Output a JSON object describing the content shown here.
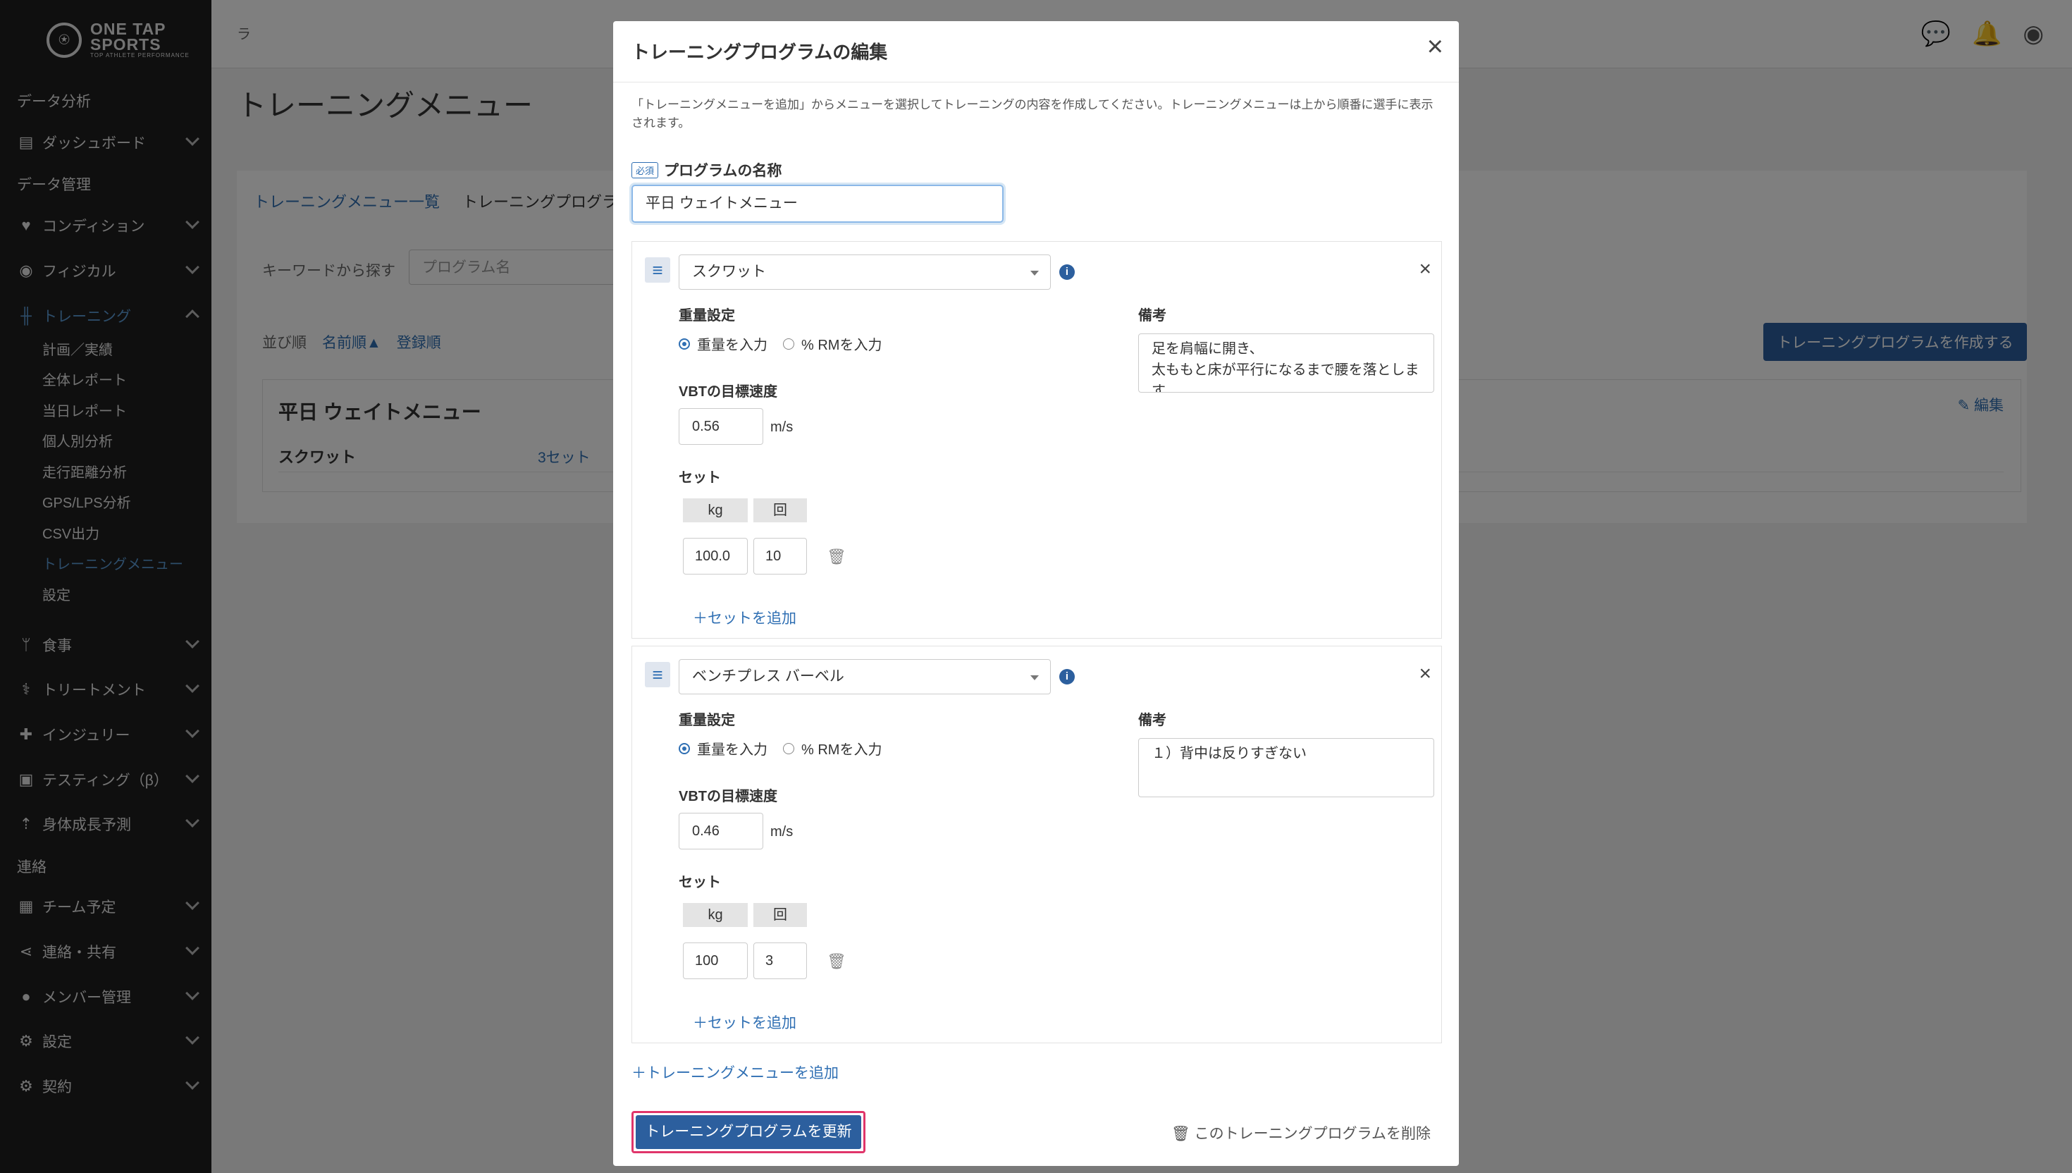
{
  "sidebar": {
    "brand_line1": "ONE TAP",
    "brand_line2": "SPORTS",
    "brand_tagline": "TOP ATHLETE PERFORMANCE",
    "sections": [
      {
        "label": "データ分析"
      },
      {
        "label": "ダッシュボード",
        "icon": "id-card-icon"
      },
      {
        "label": "データ管理"
      },
      {
        "label": "コンディション",
        "icon": "heartbeat-icon"
      },
      {
        "label": "フィジカル",
        "icon": "user-circle-icon"
      },
      {
        "label": "トレーニング",
        "icon": "dumbbell-icon"
      },
      {
        "label": "食事",
        "icon": "utensils-icon"
      },
      {
        "label": "トリートメント",
        "icon": "treatment-icon"
      },
      {
        "label": "インジュリー",
        "icon": "first-aid-icon"
      },
      {
        "label": "テスティング（β）",
        "icon": "testing-icon"
      },
      {
        "label": "身体成長予測",
        "icon": "growth-icon"
      },
      {
        "label": "連絡"
      },
      {
        "label": "チーム予定",
        "icon": "calendar-icon"
      },
      {
        "label": "連絡・共有",
        "icon": "share-icon"
      },
      {
        "label": "メンバー管理",
        "icon": "user-icon"
      },
      {
        "label": "設定",
        "icon": "gear-icon"
      },
      {
        "label": "契約",
        "icon": "gear-icon"
      }
    ],
    "training_sub": [
      "計画／実績",
      "全体レポート",
      "当日レポート",
      "個人別分析",
      "走行距離分析",
      "GPS/LPS分析",
      "CSV出力",
      "トレーニングメニュー",
      "設定"
    ]
  },
  "topbar": {
    "crumb": "ラ"
  },
  "page": {
    "title": "トレーニングメニュー",
    "tabs": [
      "トレーニングメニュー一覧",
      "トレーニングプログラ"
    ],
    "search_label": "キーワードから探す",
    "search_placeholder": "プログラム名",
    "sort_label": "並び順",
    "sort_name": "名前順▲",
    "sort_reg": "登録順",
    "create_button": "トレーニングプログラムを作成する",
    "card": {
      "name": "平日 ウェイトメニュー",
      "exercise": "スクワット",
      "sets": "3セット",
      "edit": "編集"
    }
  },
  "modal": {
    "title": "トレーニングプログラムの編集",
    "close": "×",
    "description": "「トレーニングメニューを追加」からメニューを選択してトレーニングの内容を作成してください。トレーニングメニューは上から順番に選手に表示されます。",
    "required_badge": "必須",
    "name_label": "プログラムの名称",
    "name_value": "平日 ウェイトメニュー",
    "exercises": [
      {
        "menu": "スクワット",
        "weight_setting_label": "重量設定",
        "radio_weight": "重量を入力",
        "radio_rm": "% RMを入力",
        "vbt_label": "VBTの目標速度",
        "vbt_value": "0.56",
        "vbt_unit": "m/s",
        "sets_label": "セット",
        "col_kg": "kg",
        "col_reps": "回",
        "sets": [
          {
            "kg": "100.0",
            "reps": "10"
          }
        ],
        "add_set": "セットを追加",
        "note_label": "備考",
        "note": "足を肩幅に開き、\n太ももと床が平行になるまで腰を落とします"
      },
      {
        "menu": "ベンチプレス バーベル",
        "weight_setting_label": "重量設定",
        "radio_weight": "重量を入力",
        "radio_rm": "% RMを入力",
        "vbt_label": "VBTの目標速度",
        "vbt_value": "0.46",
        "vbt_unit": "m/s",
        "sets_label": "セット",
        "col_kg": "kg",
        "col_reps": "回",
        "sets": [
          {
            "kg": "100",
            "reps": "3"
          }
        ],
        "add_set": "セットを追加",
        "note_label": "備考",
        "note": "１）背中は反りすぎない"
      }
    ],
    "add_menu": "トレーニングメニューを追加",
    "update_button": "トレーニングプログラムを更新",
    "delete_program": "このトレーニングプログラムを削除"
  }
}
